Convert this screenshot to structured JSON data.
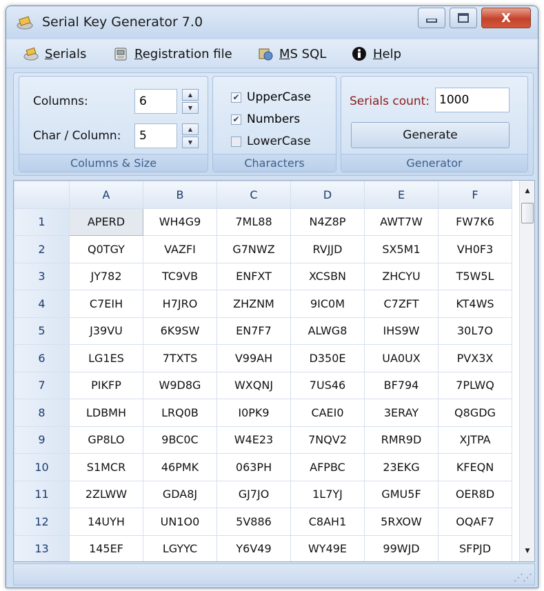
{
  "window": {
    "title": "Serial Key Generator 7.0",
    "close_label": "X"
  },
  "menu": [
    {
      "label_u": "S",
      "label_rest": "erials",
      "icon": "serials-icon"
    },
    {
      "label_u": "R",
      "label_rest": "egistration file",
      "icon": "file-icon"
    },
    {
      "label_u": "M",
      "label_rest": "S SQL",
      "icon": "database-icon"
    },
    {
      "label_u": "H",
      "label_rest": "elp",
      "icon": "info-icon"
    }
  ],
  "columns_size": {
    "columns_label": "Columns:",
    "columns_value": "6",
    "chars_label": "Char / Column:",
    "chars_value": "5",
    "caption": "Columns & Size"
  },
  "characters": {
    "uppercase": {
      "label": "UpperCase",
      "checked": true
    },
    "numbers": {
      "label": "Numbers",
      "checked": true
    },
    "lowercase": {
      "label": "LowerCase",
      "checked": false
    },
    "caption": "Characters"
  },
  "generator": {
    "count_label": "Serials count:",
    "count_value": "1000",
    "generate_label": "Generate",
    "caption": "Generator"
  },
  "grid": {
    "columns": [
      "A",
      "B",
      "C",
      "D",
      "E",
      "F"
    ],
    "rows": [
      {
        "num": "1",
        "cells": [
          "APERD",
          "WH4G9",
          "7ML88",
          "N4Z8P",
          "AWT7W",
          "FW7K6"
        ]
      },
      {
        "num": "2",
        "cells": [
          "Q0TGY",
          "VAZFI",
          "G7NWZ",
          "RVJJD",
          "SX5M1",
          "VH0F3"
        ]
      },
      {
        "num": "3",
        "cells": [
          "JY782",
          "TC9VB",
          "ENFXT",
          "XCSBN",
          "ZHCYU",
          "T5W5L"
        ]
      },
      {
        "num": "4",
        "cells": [
          "C7EIH",
          "H7JRO",
          "ZHZNM",
          "9IC0M",
          "C7ZFT",
          "KT4WS"
        ]
      },
      {
        "num": "5",
        "cells": [
          "J39VU",
          "6K9SW",
          "EN7F7",
          "ALWG8",
          "IHS9W",
          "30L7O"
        ]
      },
      {
        "num": "6",
        "cells": [
          "LG1ES",
          "7TXTS",
          "V99AH",
          "D350E",
          "UA0UX",
          "PVX3X"
        ]
      },
      {
        "num": "7",
        "cells": [
          "PIKFP",
          "W9D8G",
          "WXQNJ",
          "7US46",
          "BF794",
          "7PLWQ"
        ]
      },
      {
        "num": "8",
        "cells": [
          "LDBMH",
          "LRQ0B",
          "I0PK9",
          "CAEI0",
          "3ERAY",
          "Q8GDG"
        ]
      },
      {
        "num": "9",
        "cells": [
          "GP8LO",
          "9BC0C",
          "W4E23",
          "7NQV2",
          "RMR9D",
          "XJTPA"
        ]
      },
      {
        "num": "10",
        "cells": [
          "S1MCR",
          "46PMK",
          "063PH",
          "AFPBC",
          "23EKG",
          "KFEQN"
        ]
      },
      {
        "num": "11",
        "cells": [
          "2ZLWW",
          "GDA8J",
          "GJ7JO",
          "1L7YJ",
          "GMU5F",
          "OER8D"
        ]
      },
      {
        "num": "12",
        "cells": [
          "14UYH",
          "UN1O0",
          "5V886",
          "C8AH1",
          "5RXOW",
          "OQAF7"
        ]
      },
      {
        "num": "13",
        "cells": [
          "145EF",
          "LGYYC",
          "Y6V49",
          "WY49E",
          "99WJD",
          "SFPJD"
        ]
      }
    ],
    "selected_cell": "A1"
  }
}
